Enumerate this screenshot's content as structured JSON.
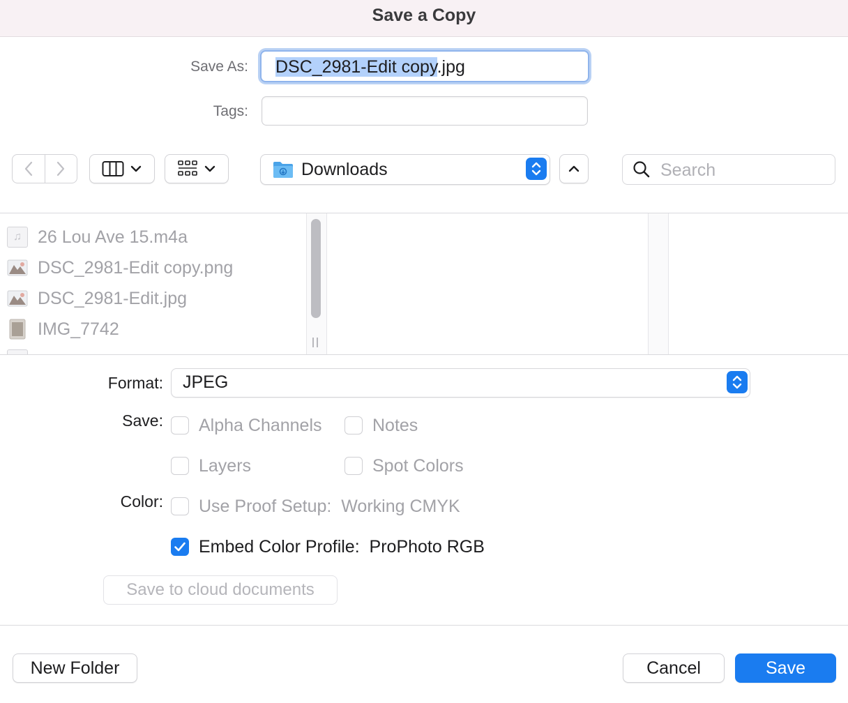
{
  "window": {
    "title": "Save a Copy"
  },
  "form": {
    "save_as_label": "Save As:",
    "filename_selected": "DSC_2981-Edit copy",
    "filename_ext": ".jpg",
    "tags_label": "Tags:",
    "tags_value": ""
  },
  "toolbar": {
    "location": "Downloads",
    "search_placeholder": "Search",
    "icons": [
      "chevron-left-icon",
      "chevron-right-icon",
      "columns-view-icon",
      "grid-group-icon",
      "folder-icon",
      "stepper-icon",
      "chevron-up-icon",
      "search-icon"
    ]
  },
  "files": [
    {
      "name": "26 Lou Ave 15.m4a",
      "kind": "audio"
    },
    {
      "name": "DSC_2981-Edit copy.png",
      "kind": "image"
    },
    {
      "name": "DSC_2981-Edit.jpg",
      "kind": "image"
    },
    {
      "name": "IMG_7742",
      "kind": "photo"
    }
  ],
  "options": {
    "format_label": "Format:",
    "format_value": "JPEG",
    "save_label": "Save:",
    "color_label": "Color:",
    "alpha_channels": {
      "label": "Alpha Channels",
      "checked": false
    },
    "notes": {
      "label": "Notes",
      "checked": false
    },
    "layers": {
      "label": "Layers",
      "checked": false
    },
    "spot_colors": {
      "label": "Spot Colors",
      "checked": false
    },
    "use_proof_setup": {
      "label": "Use Proof Setup:  Working CMYK",
      "checked": false
    },
    "embed_color_profile": {
      "label": "Embed Color Profile:  ProPhoto RGB",
      "checked": true
    },
    "cloud_button": "Save to cloud documents"
  },
  "footer": {
    "new_folder": "New Folder",
    "cancel": "Cancel",
    "save": "Save"
  },
  "colors": {
    "accent": "#1a7cf0",
    "selection": "#b3d1fb",
    "title_bar": "#f8f1f4"
  }
}
